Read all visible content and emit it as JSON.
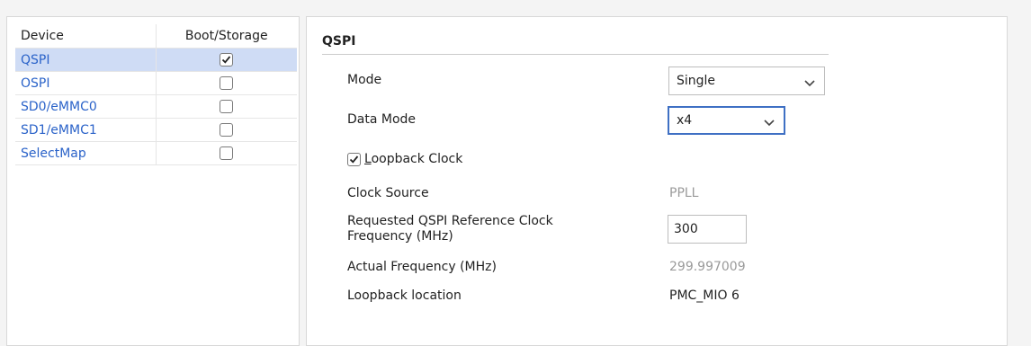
{
  "device_table": {
    "headers": {
      "device": "Device",
      "boot_storage": "Boot/Storage"
    },
    "rows": [
      {
        "name": "QSPI",
        "checked": true,
        "selected": true
      },
      {
        "name": "OSPI",
        "checked": false,
        "selected": false
      },
      {
        "name": "SD0/eMMC0",
        "checked": false,
        "selected": false
      },
      {
        "name": "SD1/eMMC1",
        "checked": false,
        "selected": false
      },
      {
        "name": "SelectMap",
        "checked": false,
        "selected": false
      }
    ]
  },
  "qspi": {
    "title": "QSPI",
    "mode": {
      "label": "Mode",
      "value": "Single"
    },
    "data_mode": {
      "label": "Data Mode",
      "value": "x4"
    },
    "loopback_clock": {
      "label_first": "L",
      "label_rest": "oopback Clock",
      "checked": true
    },
    "clock_source": {
      "label": "Clock Source",
      "value": "PPLL"
    },
    "requested_freq": {
      "label_line1": "Requested QSPI Reference Clock",
      "label_line2": "Frequency (MHz)",
      "value": "300"
    },
    "actual_freq": {
      "label": "Actual Frequency (MHz)",
      "value": "299.997009"
    },
    "loopback_location": {
      "label": "Loopback location",
      "value": "PMC_MIO 6"
    }
  },
  "colors": {
    "link_blue": "#2b63c9",
    "selection_bg": "#cfdcf5",
    "focus_border": "#3f70c4",
    "disabled_gray": "#9a9a9a"
  },
  "icons": [
    "check-icon",
    "chevron-down-icon"
  ]
}
